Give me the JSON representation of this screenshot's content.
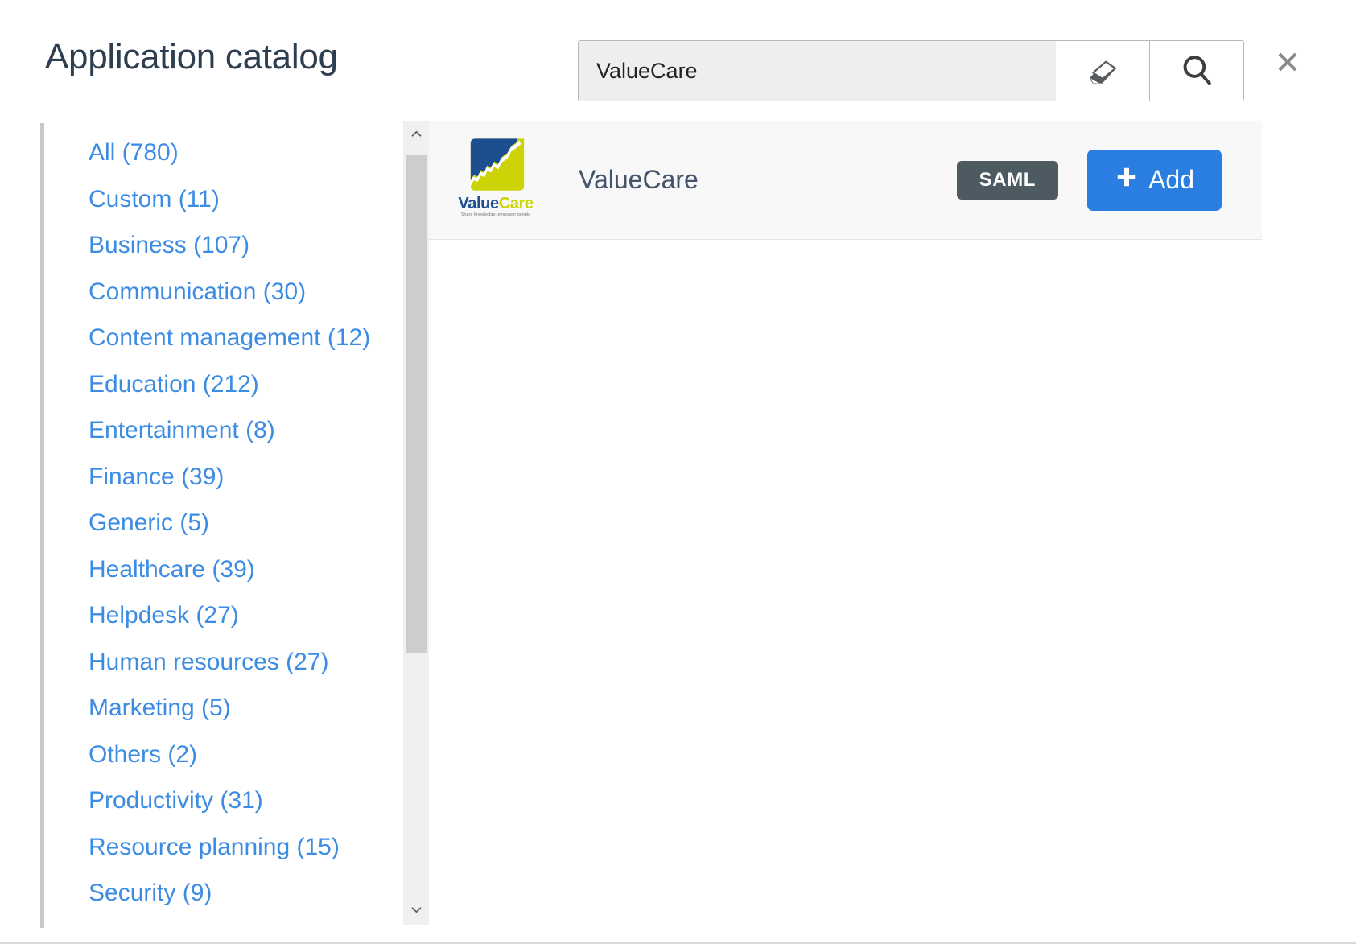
{
  "header": {
    "title": "Application catalog",
    "close_label": "✕",
    "close_icon": "close-icon"
  },
  "search": {
    "value": "ValueCare",
    "placeholder": "",
    "clear_icon": "eraser-icon",
    "search_icon": "search-icon"
  },
  "sidebar": {
    "scroll_up_icon": "chevron-up-icon",
    "scroll_down_icon": "chevron-down-icon",
    "categories": [
      {
        "label": "All (780)"
      },
      {
        "label": "Custom (11)"
      },
      {
        "label": "Business (107)"
      },
      {
        "label": "Communication (30)"
      },
      {
        "label": "Content management (12)"
      },
      {
        "label": "Education (212)"
      },
      {
        "label": "Entertainment (8)"
      },
      {
        "label": "Finance (39)"
      },
      {
        "label": "Generic (5)"
      },
      {
        "label": "Healthcare (39)"
      },
      {
        "label": "Helpdesk (27)"
      },
      {
        "label": "Human resources (27)"
      },
      {
        "label": "Marketing (5)"
      },
      {
        "label": "Others (2)"
      },
      {
        "label": "Productivity (31)"
      },
      {
        "label": "Resource planning (15)"
      },
      {
        "label": "Security (9)"
      }
    ]
  },
  "results": {
    "rows": [
      {
        "name": "ValueCare",
        "badge": "SAML",
        "add_label": "Add",
        "add_plus": "✚",
        "logo": {
          "word_1": "Value",
          "word_2": "Care",
          "tagline": "Share knowledge, empower people"
        }
      }
    ]
  },
  "colors": {
    "link_blue": "#3c8ce4",
    "add_blue": "#2a7de1",
    "badge_gray": "#4d5a61",
    "logo_blue": "#1d4e8f",
    "logo_lime": "#ccd408",
    "title_gray": "#2c3e50"
  }
}
